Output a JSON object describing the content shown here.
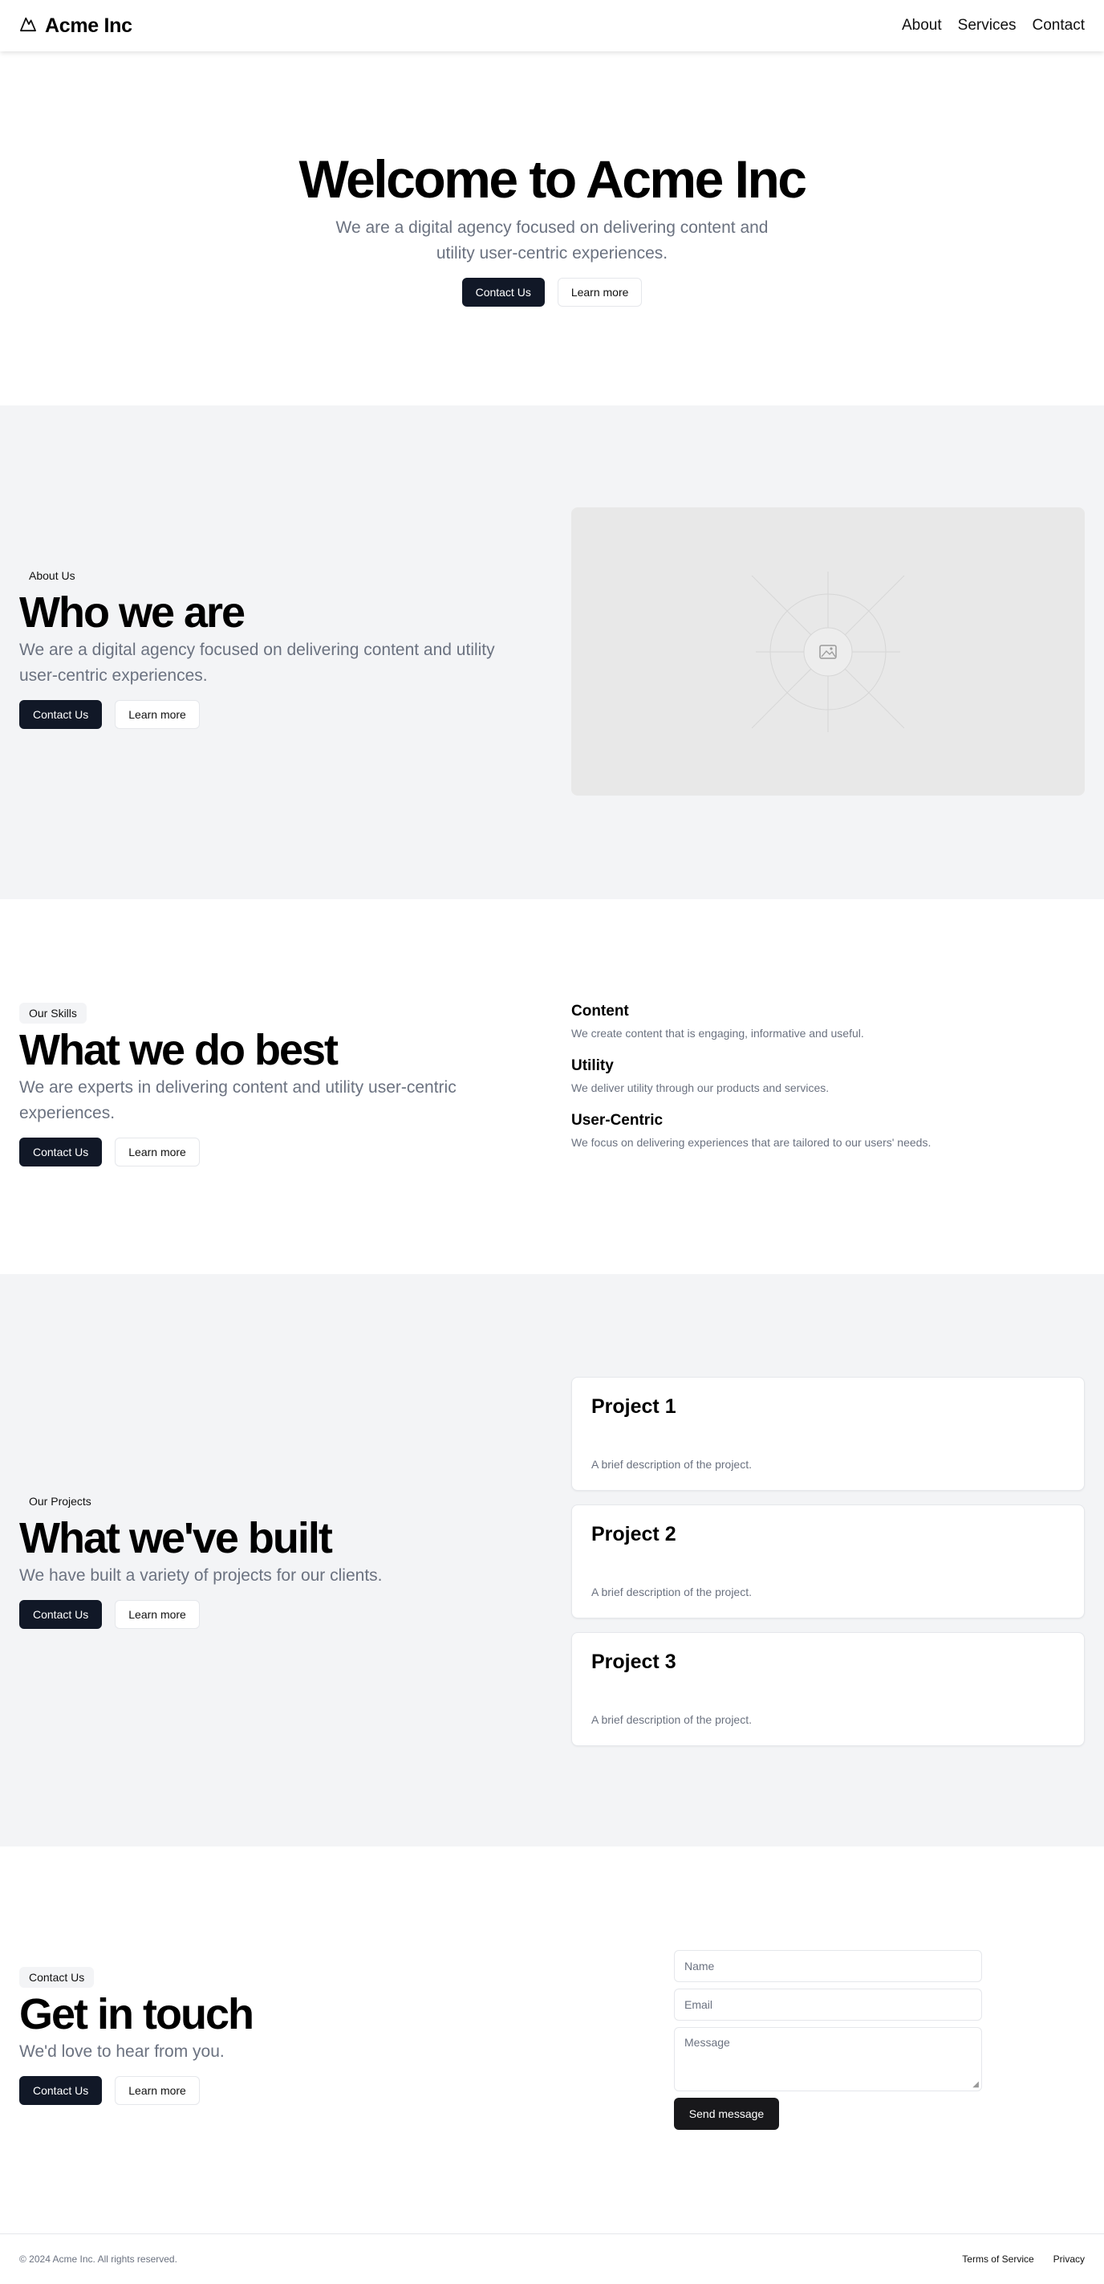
{
  "header": {
    "brand": "Acme Inc",
    "nav": [
      "About",
      "Services",
      "Contact"
    ]
  },
  "hero": {
    "title": "Welcome to Acme Inc",
    "subtitle": "We are a digital agency focused on delivering content and utility user-centric experiences.",
    "primary_button": "Contact Us",
    "secondary_button": "Learn more"
  },
  "about": {
    "badge": "About Us",
    "title": "Who we are",
    "text": "We are a digital agency focused on delivering content and utility user-centric experiences.",
    "primary_button": "Contact Us",
    "secondary_button": "Learn more",
    "image_icon": "image-placeholder-icon"
  },
  "skills": {
    "badge": "Our Skills",
    "title": "What we do best",
    "text": "We are experts in delivering content and utility user-centric experiences.",
    "primary_button": "Contact Us",
    "secondary_button": "Learn more",
    "features": [
      {
        "title": "Content",
        "text": "We create content that is engaging, informative and useful."
      },
      {
        "title": "Utility",
        "text": "We deliver utility through our products and services."
      },
      {
        "title": "User-Centric",
        "text": "We focus on delivering experiences that are tailored to our users' needs."
      }
    ]
  },
  "projects": {
    "badge": "Our Projects",
    "title": "What we've built",
    "text": "We have built a variety of projects for our clients.",
    "primary_button": "Contact Us",
    "secondary_button": "Learn more",
    "items": [
      {
        "title": "Project 1",
        "text": "A brief description of the project."
      },
      {
        "title": "Project 2",
        "text": "A brief description of the project."
      },
      {
        "title": "Project 3",
        "text": "A brief description of the project."
      }
    ]
  },
  "contact": {
    "badge": "Contact Us",
    "title": "Get in touch",
    "text": "We'd love to hear from you.",
    "primary_button": "Contact Us",
    "secondary_button": "Learn more",
    "form": {
      "name_placeholder": "Name",
      "email_placeholder": "Email",
      "message_placeholder": "Message",
      "submit": "Send message"
    }
  },
  "footer": {
    "copyright": "© 2024 Acme Inc. All rights reserved.",
    "links": [
      "Terms of Service",
      "Privacy"
    ]
  },
  "colors": {
    "primary_button": "#111827",
    "section_gray": "#f3f4f6",
    "muted_text": "#6b7280"
  }
}
